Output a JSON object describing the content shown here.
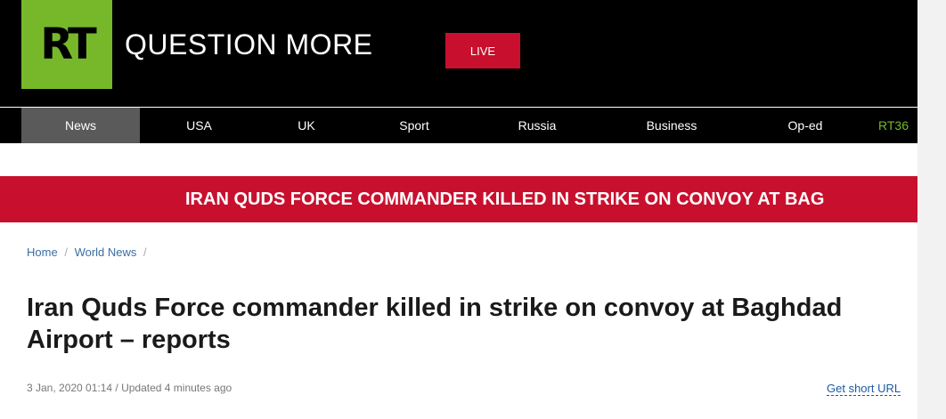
{
  "header": {
    "logo_text": "RT",
    "tagline": "QUESTION MORE",
    "live_label": "LIVE"
  },
  "nav": {
    "items": [
      {
        "label": "News",
        "active": true
      },
      {
        "label": "USA"
      },
      {
        "label": "UK"
      },
      {
        "label": "Sport"
      },
      {
        "label": "Russia"
      },
      {
        "label": "Business"
      },
      {
        "label": "Op-ed"
      },
      {
        "label": "RT36"
      }
    ]
  },
  "banner": {
    "text": "IRAN QUDS FORCE COMMANDER KILLED IN STRIKE ON CONVOY AT BAG"
  },
  "breadcrumb": {
    "home": "Home",
    "section": "World News",
    "separator": "/"
  },
  "article": {
    "title": "Iran Quds Force commander killed in strike on convoy at Baghdad Airport – reports",
    "meta": "3 Jan, 2020 01:14 / Updated 4 minutes ago",
    "short_url_label": "Get short URL"
  },
  "colors": {
    "brand_green": "#77b82a",
    "brand_red": "#c8102e",
    "nav_active": "#5a5a5a",
    "link_blue": "#1a5aa6"
  }
}
